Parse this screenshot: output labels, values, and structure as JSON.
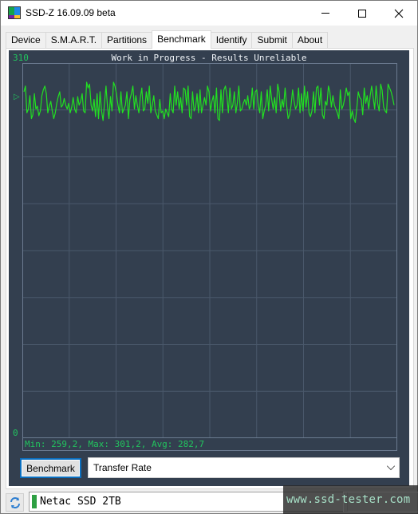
{
  "window": {
    "title": "SSD-Z 16.09.09 beta",
    "controls": {
      "minimize": "minimize",
      "maximize": "maximize",
      "close": "close"
    }
  },
  "tabs": [
    {
      "label": "Device",
      "active": false
    },
    {
      "label": "S.M.A.R.T.",
      "active": false
    },
    {
      "label": "Partitions",
      "active": false
    },
    {
      "label": "Benchmark",
      "active": true
    },
    {
      "label": "Identify",
      "active": false
    },
    {
      "label": "Submit",
      "active": false
    },
    {
      "label": "About",
      "active": false
    }
  ],
  "benchmark": {
    "graph_title": "Work in Progress - Results Unreliable",
    "y_max_label": "310",
    "y_min_label": "0",
    "avg_marker": "▷",
    "stats": "Min: 259,2, Max: 301,2, Avg: 282,7",
    "button_label": "Benchmark",
    "mode_select": "Transfer Rate"
  },
  "status": {
    "device_name": "Netac SSD 2TB",
    "led_color": "#2ea043",
    "watermark": "www.ssd-tester.com"
  },
  "colors": {
    "graph_bg": "#333f4f",
    "trace": "#22e022",
    "grid": "#4a586b",
    "label_green": "#22c55e"
  },
  "chart_data": {
    "type": "line",
    "title": "Work in Progress - Results Unreliable",
    "ylabel": "Transfer Rate",
    "ylim": [
      0,
      310
    ],
    "grid": true,
    "summary": {
      "min": 259.2,
      "max": 301.2,
      "avg": 282.7
    },
    "values": [
      290,
      296,
      268,
      272,
      286,
      262,
      266,
      288,
      272,
      275,
      265,
      270,
      286,
      292,
      296,
      288,
      268,
      275,
      280,
      270,
      262,
      268,
      278,
      285,
      290,
      274,
      276,
      283,
      276,
      272,
      278,
      268,
      274,
      284,
      272,
      268,
      285,
      276,
      280,
      288,
      270,
      268,
      300,
      294,
      298,
      276,
      270,
      282,
      264,
      288,
      262,
      290,
      270,
      260,
      278,
      296,
      274,
      262,
      285,
      270,
      300,
      296,
      288,
      276,
      268,
      290,
      268,
      272,
      276,
      290,
      262,
      282,
      288,
      296,
      272,
      286,
      276,
      268,
      284,
      294,
      270,
      272,
      290,
      278,
      296,
      268,
      276,
      286,
      270,
      266,
      262,
      282,
      268,
      270,
      262,
      272,
      268,
      264,
      288,
      272,
      268,
      296,
      276,
      290,
      272,
      284,
      268,
      294,
      292,
      276,
      296,
      264,
      262,
      290,
      270,
      274,
      288,
      268,
      292,
      268,
      276,
      284,
      276,
      296,
      290,
      270,
      280,
      286,
      268,
      294,
      262,
      260,
      292,
      268,
      292,
      296,
      286,
      268,
      294,
      272,
      276,
      290,
      268,
      278,
      296,
      270,
      272,
      278,
      282,
      276,
      286,
      272,
      276,
      294,
      272,
      290,
      292,
      276,
      268,
      290,
      262,
      270,
      276,
      292,
      270,
      296,
      282,
      272,
      284,
      268,
      298,
      290,
      270,
      282,
      274,
      294,
      276,
      262,
      266,
      276,
      292,
      280,
      272,
      276,
      294,
      268,
      288,
      270,
      296,
      274,
      290,
      268,
      264,
      270,
      290,
      268,
      294,
      296,
      276,
      294,
      266,
      262,
      280,
      276,
      296,
      290,
      274,
      286,
      276,
      272,
      268,
      262,
      292,
      272,
      276,
      284,
      294,
      286,
      290,
      262,
      270,
      262,
      258,
      272,
      290,
      284,
      282,
      266,
      294,
      278,
      286,
      272,
      286,
      296,
      284,
      272,
      296,
      278,
      270,
      298,
      292,
      274,
      270,
      268,
      298,
      294,
      290,
      284,
      276
    ]
  }
}
